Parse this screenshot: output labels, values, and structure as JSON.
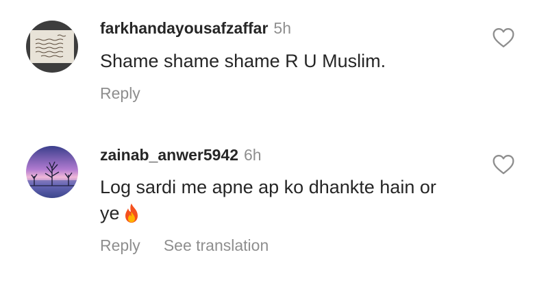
{
  "comments": [
    {
      "username": "farkhandayousafzaffar",
      "time": "5h",
      "text": "Shame shame shame R U Muslim.",
      "actions": {
        "reply": "Reply"
      },
      "avatar_icon": "urdu-text-image-avatar",
      "like_icon": "heart-outline-icon"
    },
    {
      "username": "zainab_anwer5942",
      "time": "6h",
      "text": "Log sardi me apne ap ko dhankte hain or ye",
      "emoji": "fire-emoji",
      "actions": {
        "reply": "Reply",
        "translate": "See translation"
      },
      "avatar_icon": "winter-landscape-avatar",
      "like_icon": "heart-outline-icon"
    }
  ],
  "colors": {
    "primary_text": "#262626",
    "secondary_text": "#8e8e8e",
    "background": "#ffffff"
  }
}
